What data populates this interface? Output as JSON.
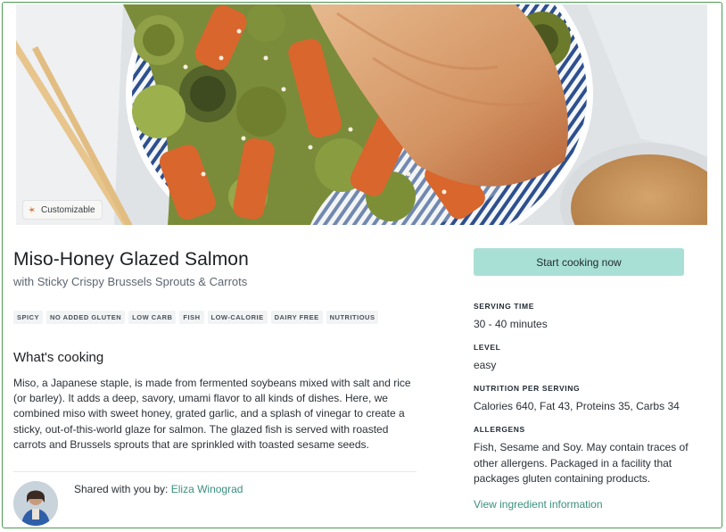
{
  "hero": {
    "badge_label": "Customizable",
    "badge_icon": "spark-icon"
  },
  "recipe": {
    "title": "Miso-Honey Glazed Salmon",
    "subtitle": "with Sticky Crispy Brussels Sprouts & Carrots",
    "tags": [
      "SPICY",
      "NO ADDED GLUTEN",
      "LOW CARB",
      "FISH",
      "LOW-CALORIE",
      "DAIRY FREE",
      "NUTRITIOUS"
    ]
  },
  "whats_cooking": {
    "heading": "What's cooking",
    "description": "Miso, a Japanese staple, is made from fermented soybeans mixed with salt and rice (or barley). It adds a deep, savory, umami flavor to all kinds of dishes. Here, we combined miso with sweet honey, grated garlic, and a splash of vinegar to create a sticky, out-of-this-world glaze for salmon. The glazed fish is served with roasted carrots and Brussels sprouts that are sprinkled with toasted sesame seeds."
  },
  "shared": {
    "prefix": "Shared with you by: ",
    "name": "Eliza Winograd"
  },
  "sidebar": {
    "start_button": "Start cooking now",
    "serving_time_label": "SERVING TIME",
    "serving_time_value": "30 - 40 minutes",
    "level_label": "LEVEL",
    "level_value": "easy",
    "nutrition_label": "NUTRITION PER SERVING",
    "nutrition_value": "Calories 640, Fat 43, Proteins 35, Carbs 34",
    "allergens_label": "ALLERGENS",
    "allergens_value": "Fish, Sesame and Soy. May contain traces of other allergens. Packaged in a facility that packages gluten containing products.",
    "view_link": "View ingredient information"
  },
  "colors": {
    "accent": "#a9e0d6",
    "link": "#3b8f7e",
    "frame": "#4e9a57"
  }
}
